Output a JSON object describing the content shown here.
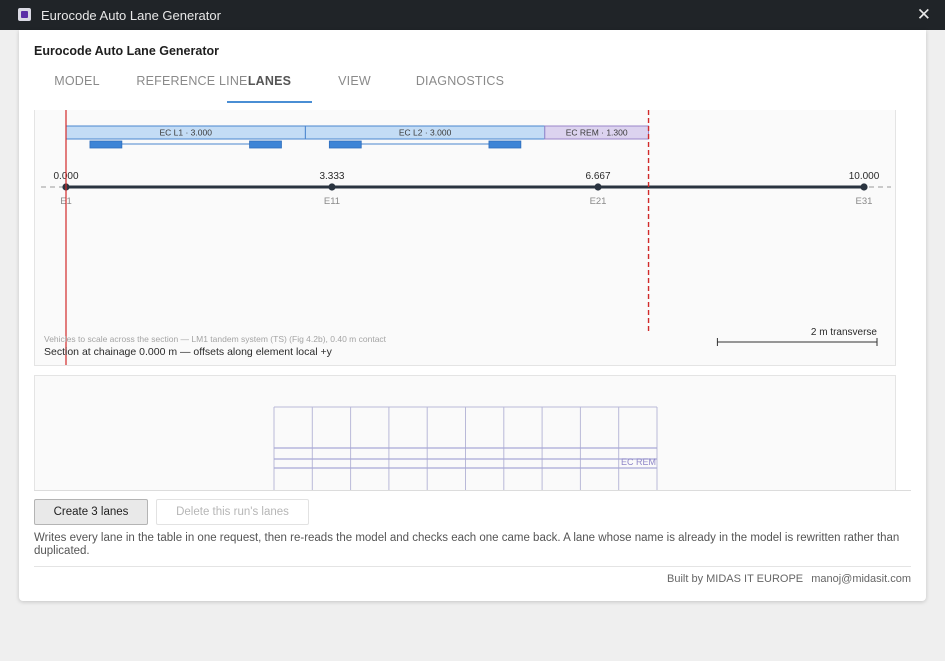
{
  "window": {
    "title": "Eurocode Auto Lane Generator",
    "icon": "app-icon",
    "close_icon": "close-icon"
  },
  "app": {
    "heading": "Eurocode Auto Lane Generator"
  },
  "tabs": [
    {
      "label": "MODEL",
      "active": false
    },
    {
      "label": "REFERENCE LINE",
      "active": false
    },
    {
      "label": "LANES",
      "active": true
    },
    {
      "label": "VIEW",
      "active": false
    },
    {
      "label": "DIAGNOSTICS",
      "active": false
    }
  ],
  "section": {
    "width_m": 10.0,
    "lanes": [
      {
        "label": "EC L1 · 3.000",
        "start": 0.0,
        "width": 3.0,
        "kind": "lane"
      },
      {
        "label": "EC L2 · 3.000",
        "start": 3.0,
        "width": 3.0,
        "kind": "lane"
      },
      {
        "label": "EC REM · 1.300",
        "start": 6.0,
        "width": 1.3,
        "kind": "remainder"
      }
    ],
    "nodes": [
      {
        "offset": 0.0,
        "label": "0.000",
        "element": "E1"
      },
      {
        "offset": 3.333,
        "label": "3.333",
        "element": "E11"
      },
      {
        "offset": 6.667,
        "label": "6.667",
        "element": "E21"
      },
      {
        "offset": 10.0,
        "label": "10.000",
        "element": "E31"
      }
    ],
    "carriageway_edge_m": 7.3,
    "scale_bar": {
      "label": "2 m transverse",
      "length_m": 2
    },
    "caption_vehicles": "Vehicles to scale across the section — LM1 tandem system (TS) (Fig 4.2b), 0.40 m contact",
    "caption_chainage": "Section at chainage 0.000 m — offsets along element local +y"
  },
  "plan": {
    "remainder_label": "EC REM"
  },
  "actions": {
    "create_label": "Create 3 lanes",
    "delete_label": "Delete this run's lanes",
    "help": "Writes every lane in the table in one request, then re-reads the model and checks each one came back. A lane whose name is already in the model is rewritten rather than duplicated."
  },
  "footer": {
    "org": "Built by MIDAS IT EUROPE",
    "email": "manoj@midasit.com"
  },
  "colors": {
    "lane_fill": "#c3dcf5",
    "lane_stroke": "#4a86cf",
    "remainder_fill": "#dcd3ef",
    "remainder_stroke": "#9a86c9",
    "wheel": "#3d84d6",
    "edge_line": "#d12a2a",
    "deck": "#2a3440",
    "tab_accent": "#4a8ed4",
    "grid": "#a9a9d6"
  }
}
